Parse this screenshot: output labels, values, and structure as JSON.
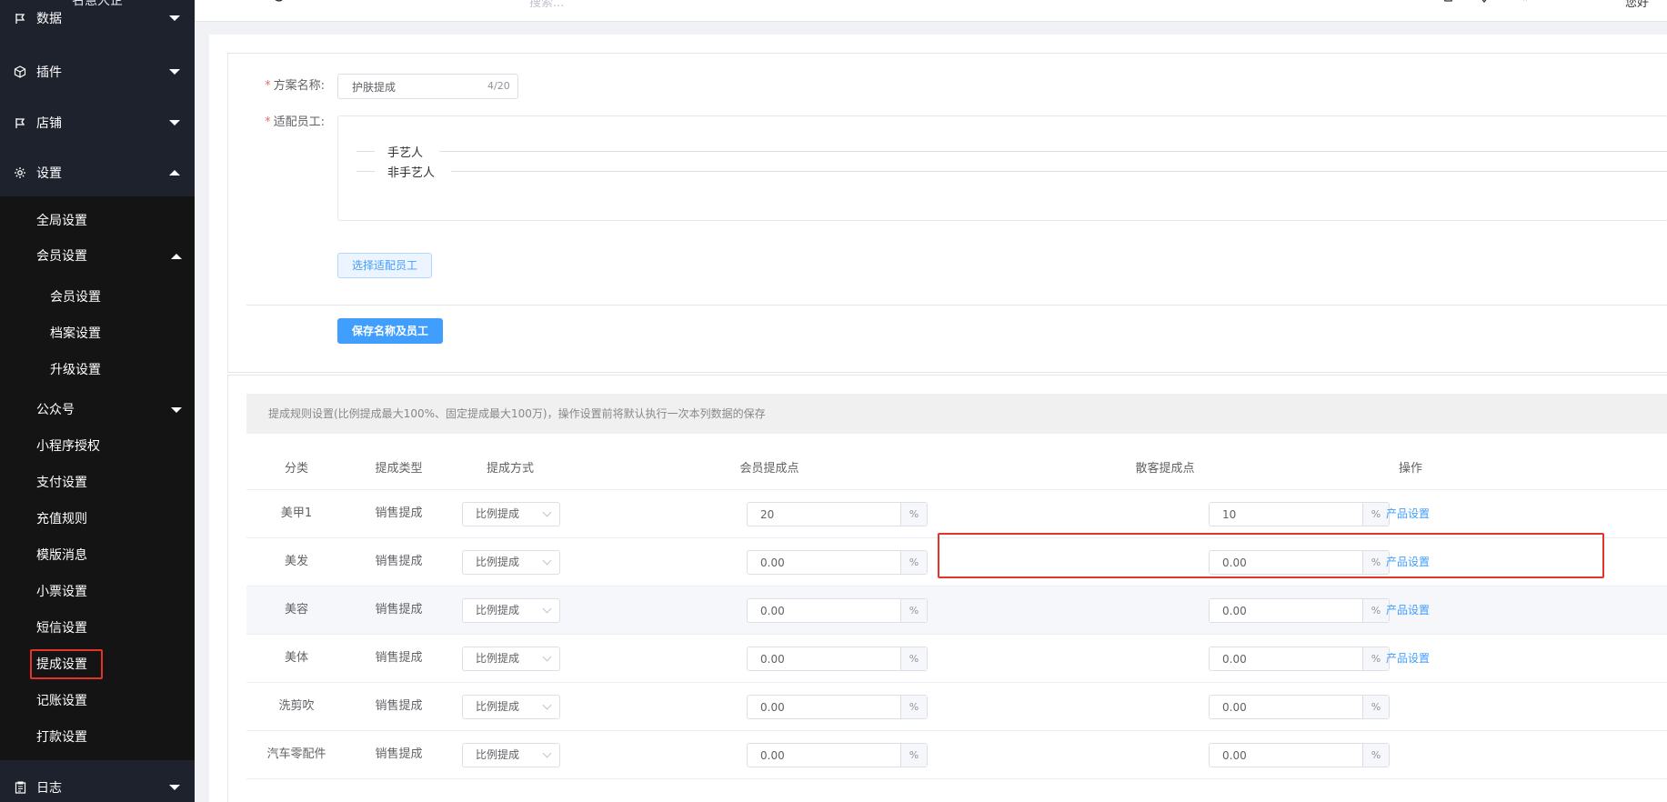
{
  "sidebar": {
    "title": "名慧大企",
    "top_items": [
      {
        "label": "数据",
        "icon": "flag-icon"
      },
      {
        "label": "插件",
        "icon": "cube-icon"
      },
      {
        "label": "店铺",
        "icon": "flag-icon"
      },
      {
        "label": "设置",
        "icon": "gear-icon"
      }
    ],
    "settings_children": [
      {
        "label": "全局设置"
      },
      {
        "label": "会员设置"
      },
      {
        "label": "会员设置"
      },
      {
        "label": "档案设置"
      },
      {
        "label": "升级设置"
      },
      {
        "label": "公众号"
      },
      {
        "label": "小程序授权"
      },
      {
        "label": "支付设置"
      },
      {
        "label": "充值规则"
      },
      {
        "label": "模版消息"
      },
      {
        "label": "小票设置"
      },
      {
        "label": "短信设置"
      },
      {
        "label": "提成设置"
      },
      {
        "label": "记账设置"
      },
      {
        "label": "打款设置"
      }
    ],
    "bottom_item": {
      "label": "日志",
      "icon": "clipboard-icon"
    }
  },
  "topbar": {
    "search_placeholder": "搜索...",
    "user_label": "您好"
  },
  "form": {
    "plan_name_label": "方案名称:",
    "plan_name_value": "护肤提成",
    "plan_name_count": "4/20",
    "staff_label": "适配员工:",
    "staff_groups": [
      "手艺人",
      "非手艺人"
    ],
    "select_staff_button": "选择适配员工",
    "save_button": "保存名称及员工"
  },
  "rules": {
    "tip": "提成规则设置(比例提成最大100%、固定提成最大100万)，操作设置前将默认执行一次本列数据的保存",
    "headers": {
      "category": "分类",
      "commission_type": "提成类型",
      "commission_method": "提成方式",
      "member_point": "会员提成点",
      "guest_point": "散客提成点",
      "operation": "操作"
    },
    "unit": "%",
    "rows": [
      {
        "category": "美甲1",
        "type": "销售提成",
        "method": "比例提成",
        "member": "20",
        "guest": "10",
        "op": "产品设置"
      },
      {
        "category": "美发",
        "type": "销售提成",
        "method": "比例提成",
        "member": "0.00",
        "guest": "0.00",
        "op": "产品设置"
      },
      {
        "category": "美容",
        "type": "销售提成",
        "method": "比例提成",
        "member": "0.00",
        "guest": "0.00",
        "op": "产品设置"
      },
      {
        "category": "美体",
        "type": "销售提成",
        "method": "比例提成",
        "member": "0.00",
        "guest": "0.00",
        "op": "产品设置"
      },
      {
        "category": "洗剪吹",
        "type": "销售提成",
        "method": "比例提成",
        "member": "0.00",
        "guest": "0.00",
        "op": ""
      },
      {
        "category": "汽车零配件",
        "type": "销售提成",
        "method": "比例提成",
        "member": "0.00",
        "guest": "0.00",
        "op": ""
      }
    ]
  },
  "colors": {
    "sidebar_bg": "#1e222d",
    "submenu_bg": "#141414",
    "primary": "#409eff",
    "highlight": "#e5332a"
  }
}
